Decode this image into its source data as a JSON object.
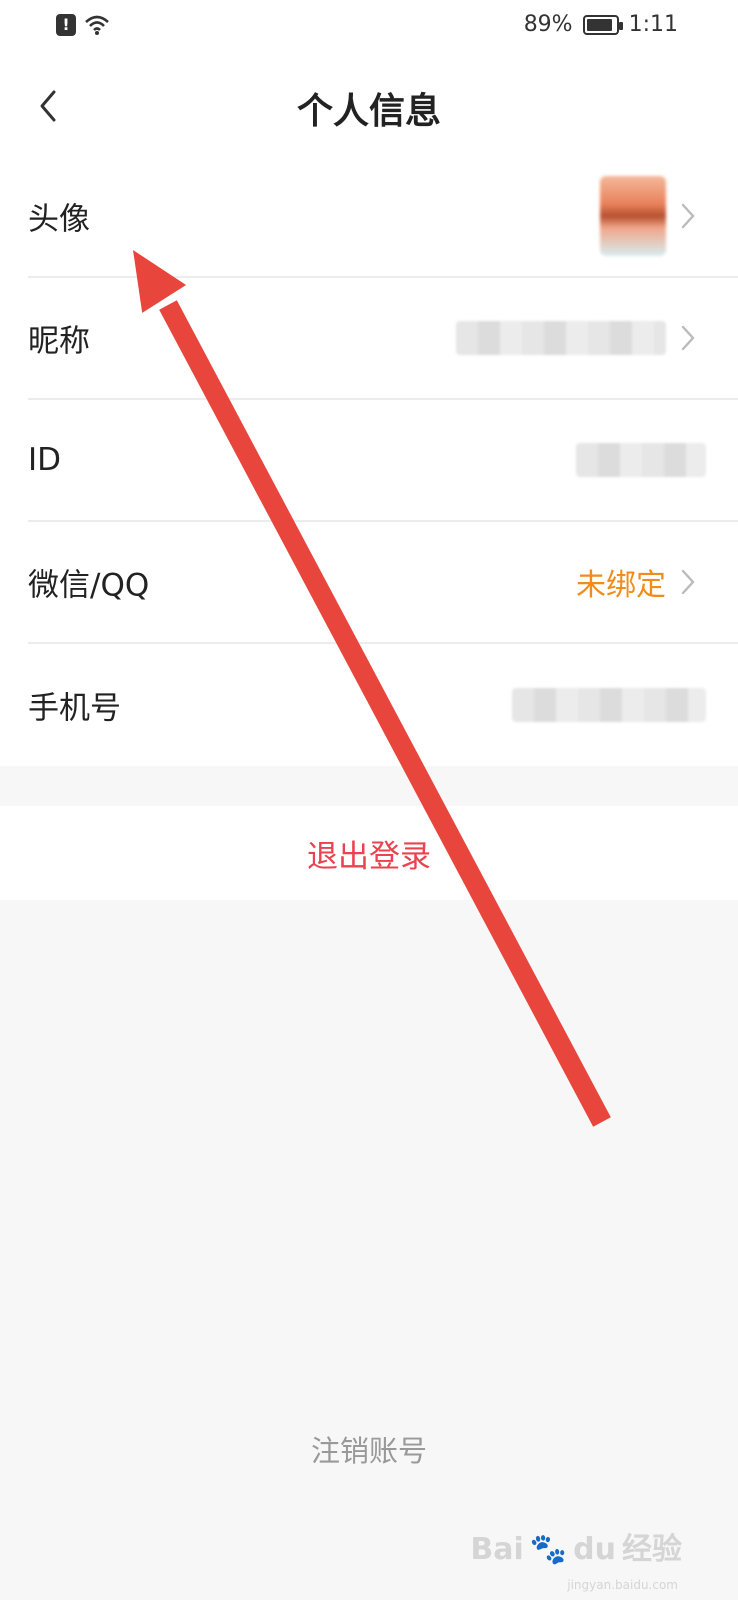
{
  "status_bar": {
    "battery_percent_text": "89%",
    "battery_level": 0.89,
    "time": "1:11",
    "icons": [
      "alert-icon",
      "wifi-icon",
      "battery-icon"
    ]
  },
  "header": {
    "title": "个人信息",
    "back_icon": "chevron-left-icon"
  },
  "profile_rows": {
    "avatar": {
      "label": "头像"
    },
    "nickname": {
      "label": "昵称"
    },
    "id": {
      "label": "ID"
    },
    "wechat_qq": {
      "label": "微信/QQ",
      "value": "未绑定"
    },
    "phone": {
      "label": "手机号"
    }
  },
  "logout": {
    "label": "退出登录"
  },
  "cancel_account": {
    "label": "注销账号"
  },
  "watermark": {
    "brand": "Bai",
    "brand2": "du",
    "brand_cn": "经验",
    "url": "jingyan.baidu.com"
  },
  "colors": {
    "accent_red": "#e8434f",
    "unbound_orange": "#f08c1a",
    "arrow_red": "#e8453c",
    "background": "#f7f7f7"
  }
}
